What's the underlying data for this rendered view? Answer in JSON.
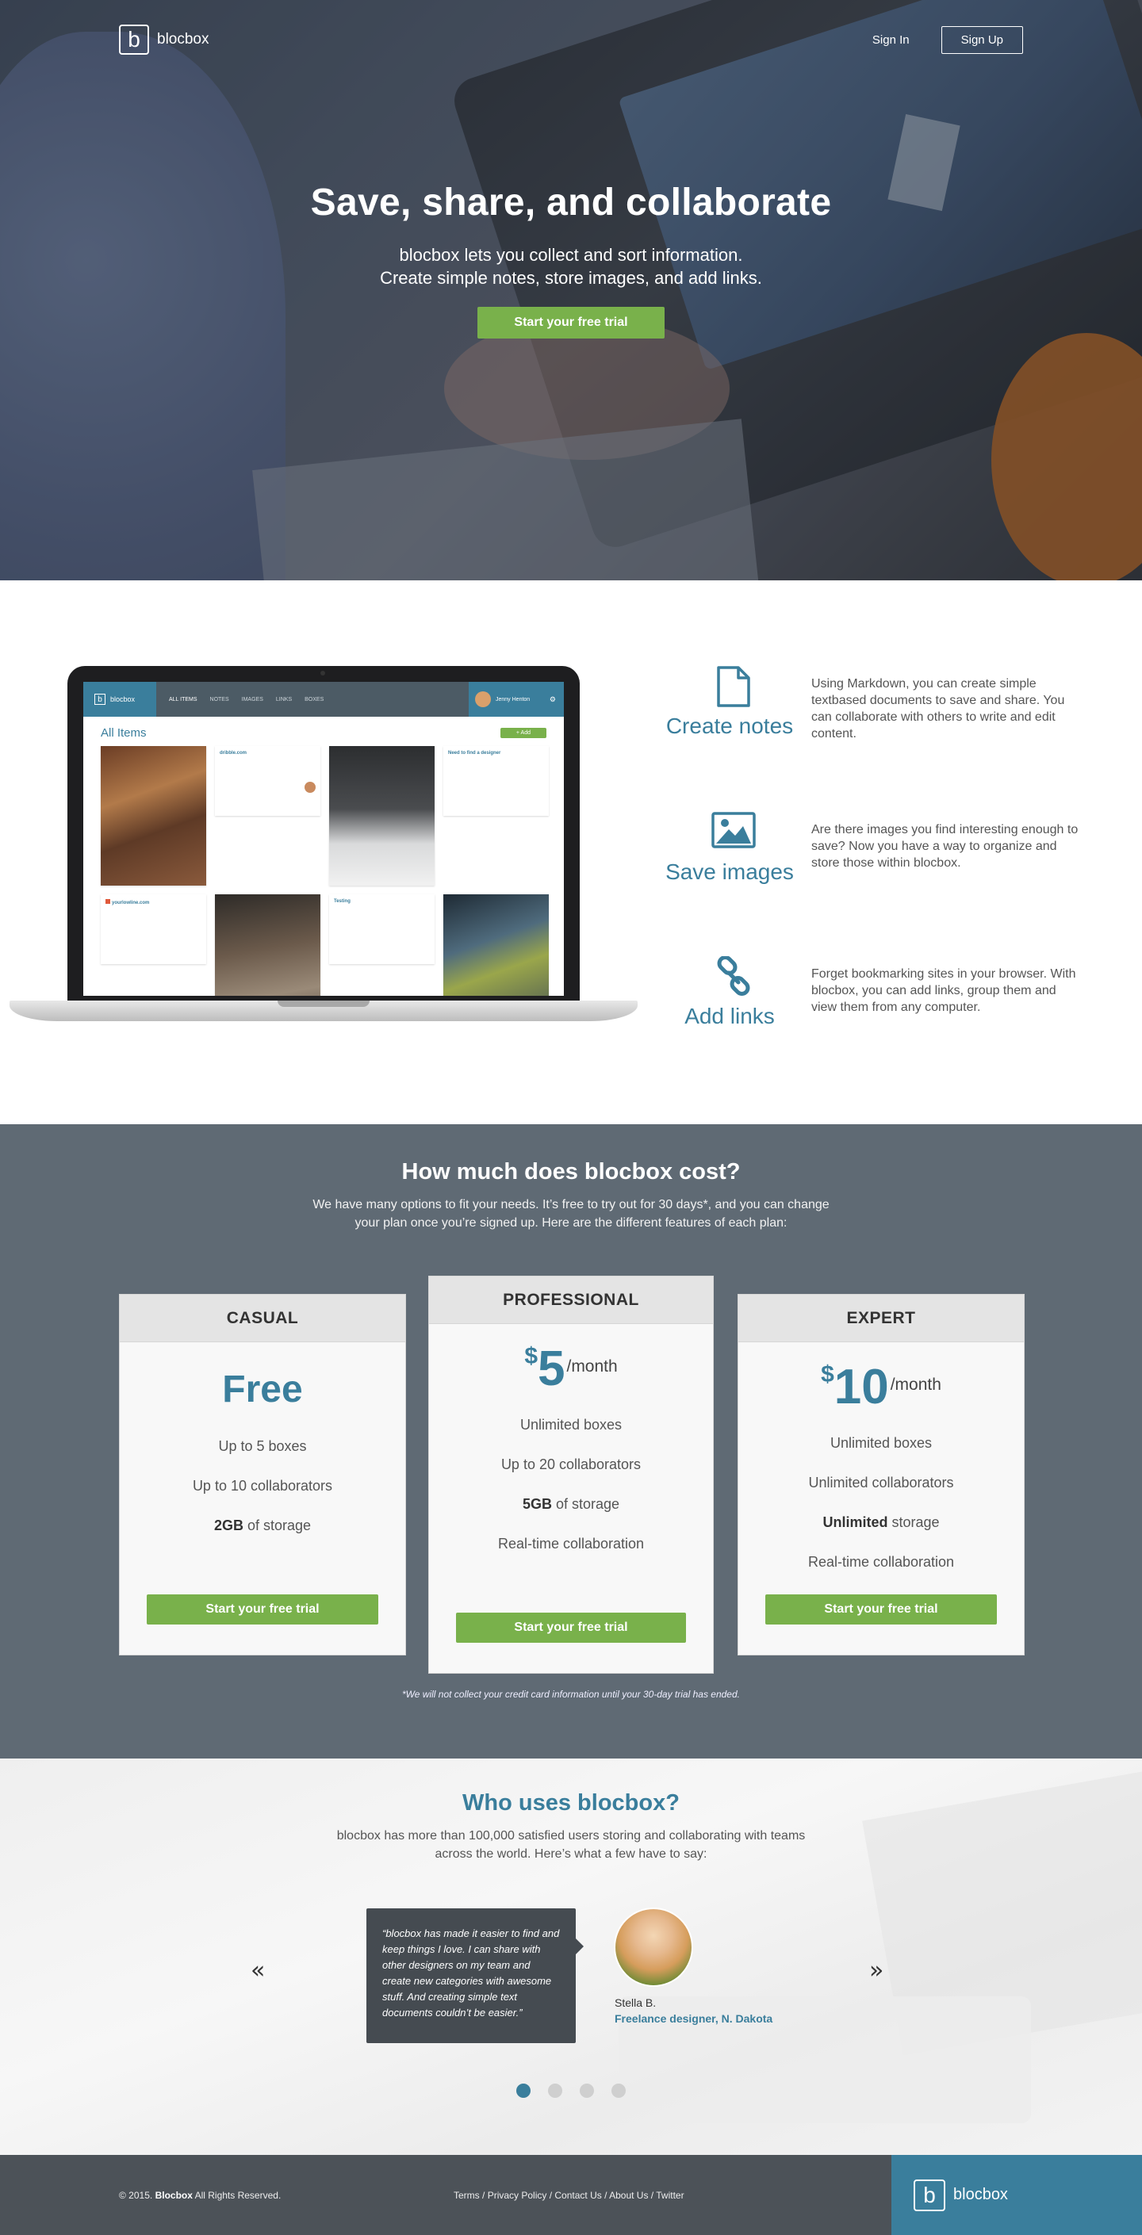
{
  "brand": {
    "name": "blocbox",
    "logo_letter": "b"
  },
  "nav": {
    "signin": "Sign In",
    "signup": "Sign Up"
  },
  "hero": {
    "title": "Save, share, and collaborate",
    "subtitle_line1": "blocbox lets you collect and sort information.",
    "subtitle_line2": "Create simple notes, store images, and add links.",
    "cta": "Start your free trial"
  },
  "app_preview": {
    "brand": "blocbox",
    "tabs": [
      "ALL ITEMS",
      "NOTES",
      "IMAGES",
      "LINKS",
      "BOXES"
    ],
    "user": "Jenny Henton",
    "title": "All Items",
    "add_button": "+ Add",
    "card_titles": [
      "dribble.com",
      "Need to find a designer",
      "yourlowline.com",
      "Testing"
    ]
  },
  "features": [
    {
      "icon": "document-icon",
      "name": "Create notes",
      "desc": "Using Markdown, you can create simple textbased documents to save and share. You can collaborate with others to write and edit content."
    },
    {
      "icon": "image-icon",
      "name": "Save images",
      "desc": "Are there images you find interesting enough  to save? Now you have a way to organize and store those within blocbox."
    },
    {
      "icon": "link-icon",
      "name": "Add links",
      "desc": "Forget bookmarking sites in your browser. With blocbox, you can add links, group them and view them from any computer."
    }
  ],
  "pricing": {
    "title": "How much does blocbox cost?",
    "intro": "We have many options to fit your needs. It’s free to try out for 30 days*, and you can change your plan once you’re signed up. Here are the different features of each plan:",
    "note": "*We will not collect your credit card information until your 30-day trial has ended.",
    "plans": [
      {
        "name": "CASUAL",
        "price": "Free",
        "features": [
          "Up to 5 boxes",
          "Up to 10 collaborators"
        ],
        "storage_bold": "2GB",
        "storage_rest": " of storage",
        "cta": "Start your free trial"
      },
      {
        "name": "PROFESSIONAL",
        "currency": "$",
        "amount": "5",
        "per": "/month",
        "features": [
          "Unlimited boxes",
          "Up to 20 collaborators"
        ],
        "storage_bold": "5GB",
        "storage_rest": " of storage",
        "extra": "Real-time collaboration",
        "cta": "Start your free trial"
      },
      {
        "name": "EXPERT",
        "currency": "$",
        "amount": "10",
        "per": "/month",
        "features": [
          "Unlimited boxes",
          "Unlimited collaborators"
        ],
        "storage_bold": "Unlimited",
        "storage_rest": " storage",
        "extra": "Real-time collaboration",
        "cta": "Start your free trial"
      }
    ]
  },
  "testimonials": {
    "title": "Who uses blocbox?",
    "intro": "blocbox has more than 100,000 satisfied users storing and collaborating with teams across the world. Here’s what a few have to say:",
    "quote": "“blocbox has made it easier to find and keep things I love. I can share with other designers on my team and create new categories with awesome stuff. And creating simple text documents couldn’t be easier.”",
    "name": "Stella B.",
    "role": "Freelance designer, N. Dakota",
    "prev": "«",
    "next": "»",
    "slides": 4,
    "active_slide": 1
  },
  "footer": {
    "copy_prefix": "© 2015.",
    "copy_brand": "Blocbox",
    "copy_suffix": "All Rights Reserved.",
    "links": [
      "Terms",
      "Privacy Policy",
      "Contact Us",
      "About Us",
      "Twitter"
    ]
  },
  "colors": {
    "accent": "#3a7e9c",
    "cta": "#79b14b",
    "pricing_bg": "#5f6a74",
    "footer_bg": "#4c5258"
  }
}
